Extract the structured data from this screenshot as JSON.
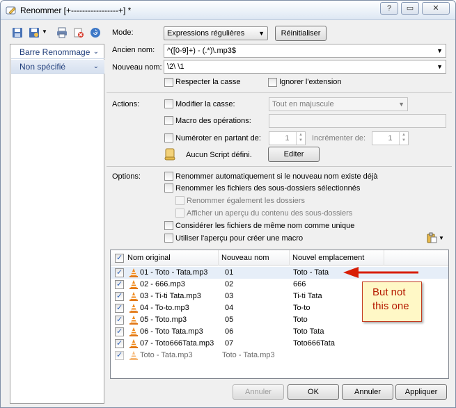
{
  "window": {
    "title": "Renommer [+-----------------+] *",
    "controls": {
      "help": "?",
      "restore": "▭",
      "close": "✕"
    }
  },
  "left_toolbar": {
    "icons": [
      "save-icon",
      "save-as-icon",
      "dropdown-arrow-icon",
      "printer-icon",
      "delete-icon",
      "refresh-icon"
    ]
  },
  "left_panel": {
    "items": [
      {
        "label": "Barre Renommage"
      },
      {
        "label": "Non spécifié"
      }
    ]
  },
  "mode": {
    "label": "Mode:",
    "value": "Expressions régulières",
    "reset_button": "Réinitialiser"
  },
  "old_name": {
    "label": "Ancien nom:",
    "value": "^([0-9]+) - (.*)\\.mp3$"
  },
  "new_name": {
    "label": "Nouveau nom:",
    "value": "\\2\\ \\1"
  },
  "options_row": {
    "match_case": "Respecter la casse",
    "ignore_extension": "Ignorer l'extension"
  },
  "actions": {
    "label": "Actions:",
    "modify_case": "Modifier la casse:",
    "case_value": "Tout en majuscule",
    "macro": "Macro des opérations:",
    "numbering": "Numéroter en partant de:",
    "start_value": "1",
    "increment_label": "Incrémenter de:",
    "increment_value": "1",
    "script_label": "Aucun Script défini.",
    "edit_button": "Editer"
  },
  "options": {
    "label": "Options:",
    "auto_rename": "Renommer automatiquement si le nouveau nom existe déjà",
    "rename_subfolder_files": "Renommer les fichiers des sous-dossiers sélectionnés",
    "rename_folders": "Renommer également les dossiers",
    "preview_subfolders": "Afficher un aperçu du contenu des sous-dossiers",
    "same_name_unique": "Considérer les fichiers de même nom comme unique",
    "use_preview_macro": "Utiliser l'aperçu pour créer une macro"
  },
  "file_list": {
    "columns": [
      "Nom original",
      "Nouveau nom",
      "Nouvel emplacement"
    ],
    "rows": [
      {
        "original": "01 - Toto - Tata.mp3",
        "new_name": "01",
        "location": "Toto - Tata"
      },
      {
        "original": "02 - 666.mp3",
        "new_name": "02",
        "location": "666"
      },
      {
        "original": "03 - Ti-ti Tata.mp3",
        "new_name": "03",
        "location": "Ti-ti Tata"
      },
      {
        "original": "04 - To-to.mp3",
        "new_name": "04",
        "location": "To-to"
      },
      {
        "original": "05 - Toto.mp3",
        "new_name": "05",
        "location": "Toto"
      },
      {
        "original": "06 - Toto Tata.mp3",
        "new_name": "06",
        "location": "Toto Tata"
      },
      {
        "original": "07 - Toto666Tata.mp3",
        "new_name": "07",
        "location": "Toto666Tata"
      },
      {
        "original": "Toto - Tata.mp3",
        "new_name": "Toto - Tata.mp3",
        "location": ""
      }
    ]
  },
  "annotation": {
    "line1": "But not",
    "line2": "this one",
    "color": "#d81e05"
  },
  "footer": {
    "annuler_disabled": "Annuler",
    "ok": "OK",
    "annuler": "Annuler",
    "appliquer": "Appliquer"
  }
}
